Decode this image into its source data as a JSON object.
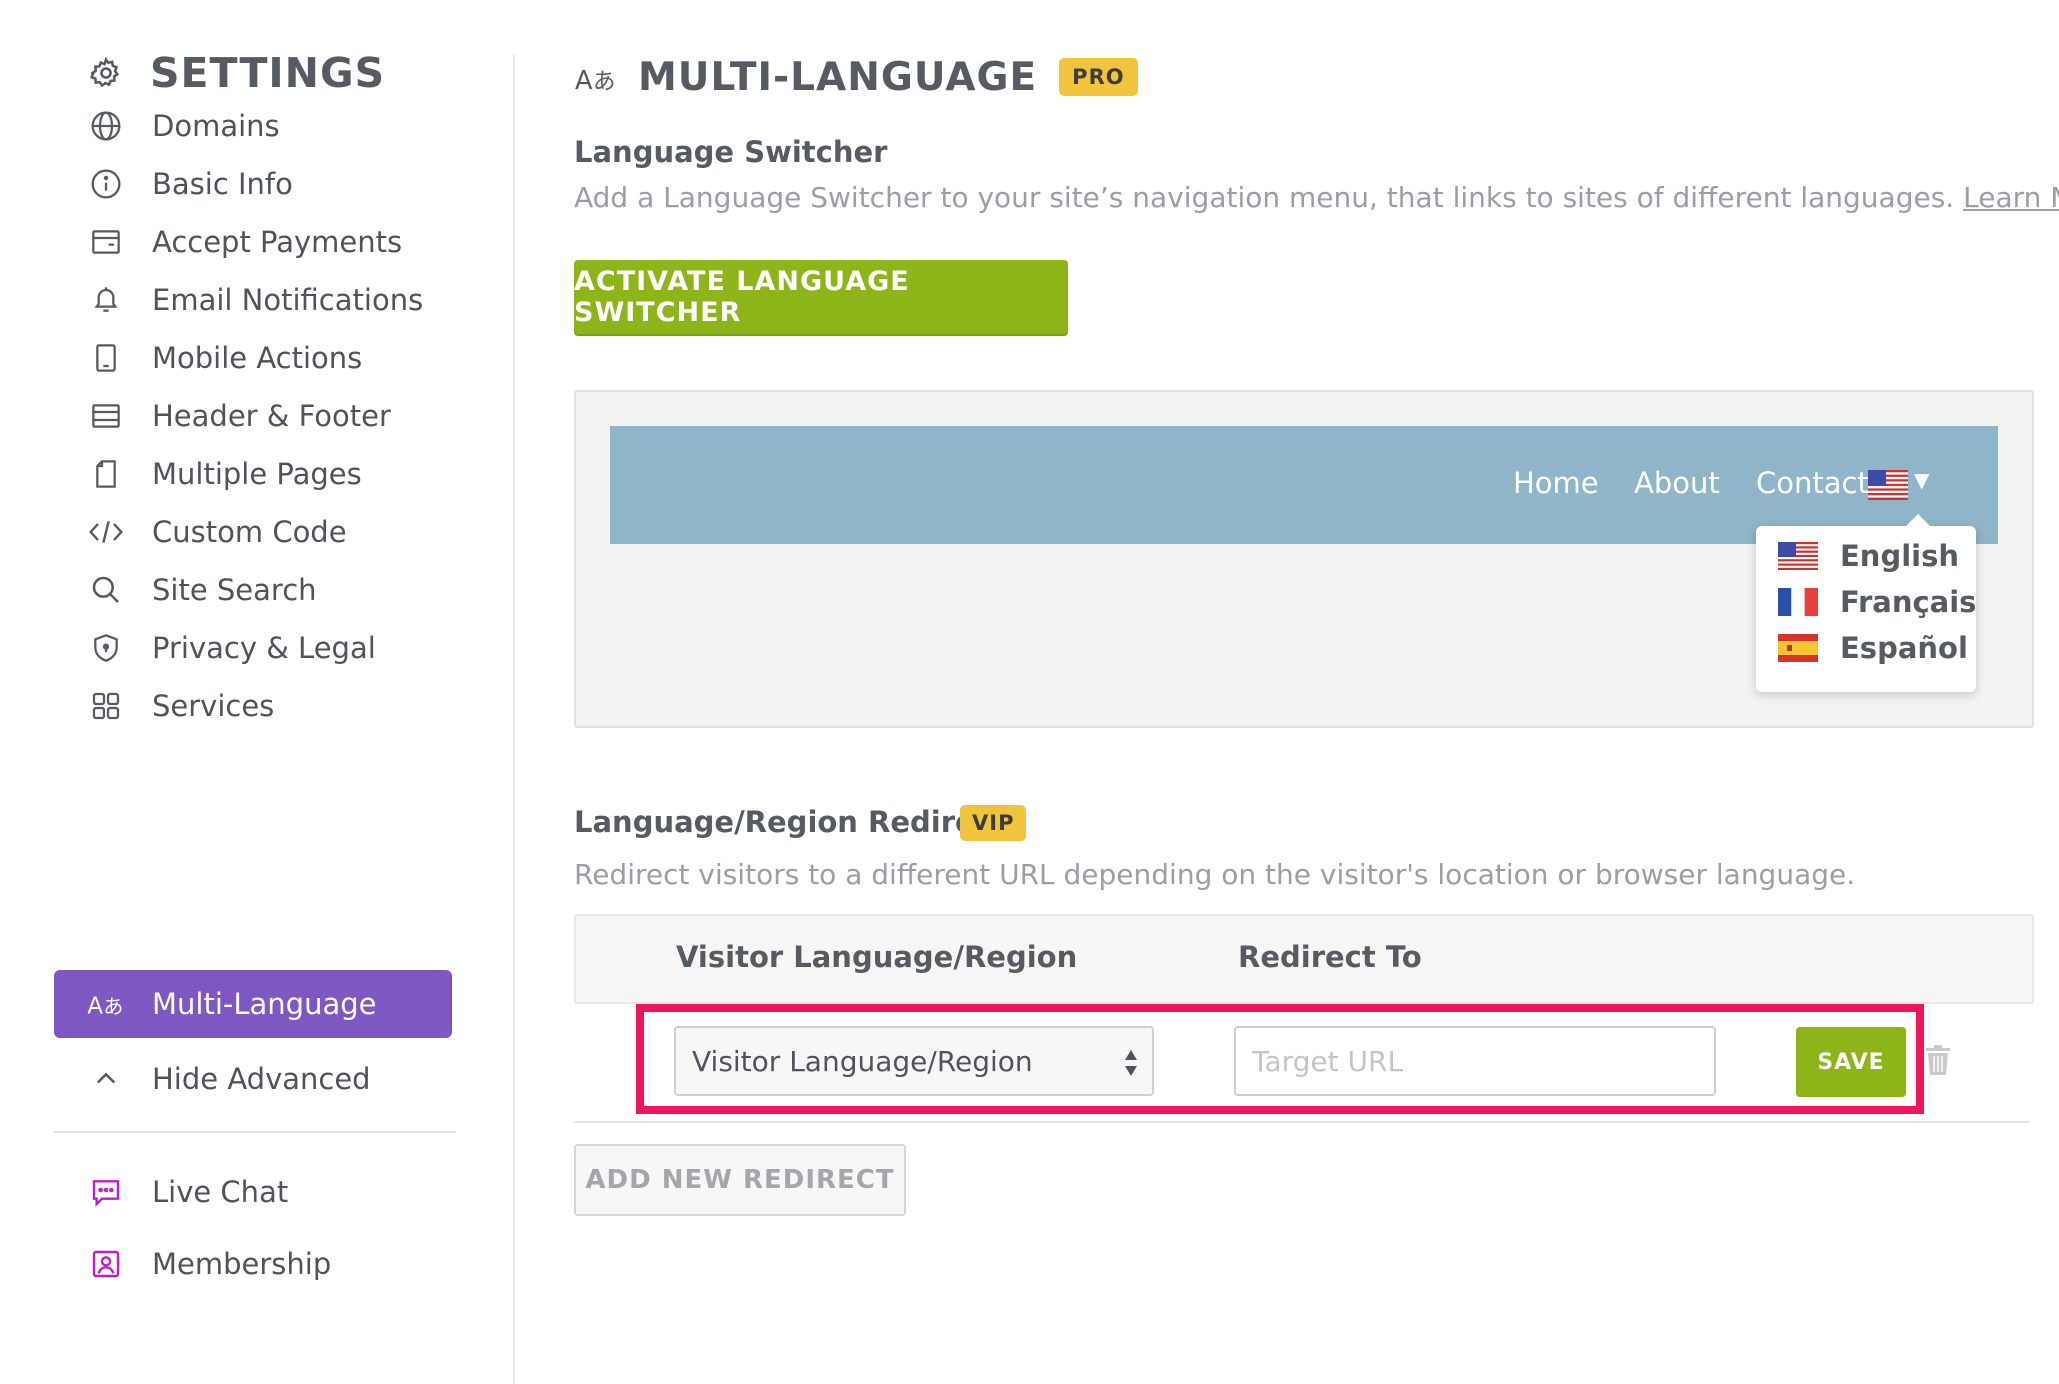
{
  "sidebar": {
    "title": "SETTINGS",
    "items": [
      {
        "label": "Domains",
        "icon": "globe-icon"
      },
      {
        "label": "Basic Info",
        "icon": "info-icon"
      },
      {
        "label": "Accept Payments",
        "icon": "wallet-icon"
      },
      {
        "label": "Email Notifications",
        "icon": "bell-icon"
      },
      {
        "label": "Mobile Actions",
        "icon": "mobile-icon"
      },
      {
        "label": "Header & Footer",
        "icon": "layout-icon"
      },
      {
        "label": "Multiple Pages",
        "icon": "page-icon"
      },
      {
        "label": "Custom Code",
        "icon": "code-icon"
      },
      {
        "label": "Site Search",
        "icon": "search-icon"
      },
      {
        "label": "Privacy & Legal",
        "icon": "shield-icon"
      },
      {
        "label": "Services",
        "icon": "grid-icon"
      },
      {
        "label": "Multi-Language",
        "icon": "translate-icon",
        "active": true
      },
      {
        "label": "Hide Advanced",
        "icon": "chevron-up-icon"
      }
    ],
    "extras": [
      {
        "label": "Live Chat",
        "icon": "chat-icon"
      },
      {
        "label": "Membership",
        "icon": "member-icon"
      }
    ],
    "active_color": "#7e57c2",
    "extras_icon_color": "#c020c0"
  },
  "main": {
    "title": "MULTI-LANGUAGE",
    "title_badge": "PRO",
    "switcher": {
      "title": "Language Switcher",
      "description": "Add a Language Switcher to your site’s navigation menu, that links to sites of different languages.",
      "learn_more": "Learn More",
      "activate_button": "ACTIVATE LANGUAGE SWITCHER"
    },
    "preview": {
      "nav_links": [
        "Home",
        "About",
        "Contact"
      ],
      "languages": [
        {
          "label": "English",
          "flag": "us-flag-icon"
        },
        {
          "label": "Français",
          "flag": "fr-flag-icon"
        },
        {
          "label": "Español",
          "flag": "es-flag-icon"
        }
      ],
      "nav_color": "#8fb5c8"
    },
    "redirect": {
      "title": "Language/Region Redirect",
      "badge": "VIP",
      "description": "Redirect visitors to a different URL depending on the visitor's location or browser language.",
      "columns": [
        "Visitor Language/Region",
        "Redirect To"
      ],
      "select_value": "Visitor Language/Region",
      "url_placeholder": "Target URL",
      "save_button": "SAVE",
      "add_button": "ADD NEW REDIRECT",
      "highlight_color": "#f0165e"
    },
    "accent_green": "#8db51a",
    "badge_color": "#f0c53d"
  }
}
